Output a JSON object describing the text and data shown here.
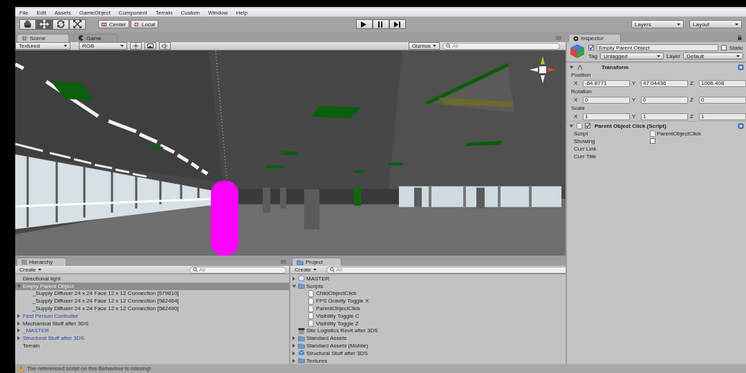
{
  "menu": [
    "File",
    "Edit",
    "Assets",
    "GameObject",
    "Component",
    "Terrain",
    "Custom",
    "Window",
    "Help"
  ],
  "toolbar": {
    "tools": [
      {
        "kind": "hand",
        "selected": false
      },
      {
        "kind": "move",
        "selected": true
      },
      {
        "kind": "rotate",
        "selected": false
      },
      {
        "kind": "scale",
        "selected": false
      }
    ],
    "pivot_buttons": [
      {
        "kind": "center",
        "label": "Center"
      },
      {
        "kind": "local",
        "label": "Local"
      }
    ],
    "playback": [
      {
        "kind": "play"
      },
      {
        "kind": "pause"
      },
      {
        "kind": "step"
      }
    ],
    "layers": "Layers",
    "layout": "Layout"
  },
  "scene_panel": {
    "tabs": [
      {
        "label": "Scene",
        "kind": "scene",
        "selected": true
      },
      {
        "label": "Game",
        "kind": "game",
        "selected": false
      }
    ],
    "render_mode": "Textured",
    "color_mode": "RGB",
    "toggles": [
      {
        "kind": "light"
      },
      {
        "kind": "image"
      },
      {
        "kind": "audio"
      }
    ],
    "gizmos": "Gizmos",
    "search_placeholder": "All"
  },
  "inspector": {
    "title": "Inspector",
    "active": true,
    "object_name": "Empty Parent Object",
    "static_label": "Static",
    "static": false,
    "tag_label": "Tag",
    "tag": "Untagged",
    "layer_label": "Layer",
    "layer": "Default",
    "components": [
      {
        "kind": "transform",
        "title": "Transform",
        "expanded": true,
        "groups": [
          {
            "label": "Position",
            "fields": [
              {
                "axis": "X",
                "value": "-64.8771"
              },
              {
                "axis": "Y",
                "value": "47.04436"
              },
              {
                "axis": "Z",
                "value": "1006.408"
              }
            ]
          },
          {
            "label": "Rotation",
            "fields": [
              {
                "axis": "X",
                "value": "0"
              },
              {
                "axis": "Y",
                "value": "0"
              },
              {
                "axis": "Z",
                "value": "0"
              }
            ]
          },
          {
            "label": "Scale",
            "fields": [
              {
                "axis": "X",
                "value": "1"
              },
              {
                "axis": "Y",
                "value": "1"
              },
              {
                "axis": "Z",
                "value": "1"
              }
            ]
          }
        ]
      },
      {
        "kind": "script",
        "title": "Parent Object Click (Script)",
        "expanded": true,
        "enabled": true,
        "properties": [
          {
            "label": "Script",
            "kind": "object",
            "value": "ParentObjectClick"
          },
          {
            "label": "Showing",
            "kind": "toggle",
            "checked": false
          },
          {
            "label": "Curr Link",
            "kind": "empty"
          },
          {
            "label": "Curr Title",
            "kind": "empty"
          }
        ]
      }
    ]
  },
  "hierarchy": {
    "title": "Hierarchy",
    "create": "Create",
    "search_placeholder": "All",
    "items": [
      {
        "label": "Directional light",
        "prefab": false,
        "selected": false
      },
      {
        "label": "Empty Parent Object",
        "prefab": false,
        "selected": true,
        "expanded": true,
        "children": [
          {
            "label": "_Supply Diffuser 24 x 24 Face 12 x 12 Connection [579810]",
            "prefab": false,
            "selected": false
          },
          {
            "label": "_Supply Diffuser 24 x 24 Face 12 x 12 Connection [582464]",
            "prefab": false,
            "selected": false
          },
          {
            "label": "_Supply Diffuser 24 x 24 Face 12 x 12 Connection [582490]",
            "prefab": false,
            "selected": false
          }
        ]
      },
      {
        "label": "First Person Controller",
        "prefab": true,
        "selected": false,
        "expanded": false
      },
      {
        "label": "Mechanical Stuff after 3DS",
        "prefab": false,
        "selected": false,
        "expanded": false
      },
      {
        "label": "_MASTER",
        "prefab": true,
        "selected": false,
        "expanded": false
      },
      {
        "label": "Structural Stuff after 3DS",
        "prefab": true,
        "selected": false,
        "expanded": false
      },
      {
        "label": "Terrain",
        "prefab": false,
        "selected": false
      }
    ]
  },
  "project": {
    "title": "Project",
    "create": "Create",
    "search_placeholder": "All",
    "items": [
      {
        "label": "MASTER",
        "kind": "scene",
        "expanded": false,
        "selected": false
      },
      {
        "label": "Scripts",
        "kind": "folder",
        "expanded": true,
        "selected": false,
        "children": [
          {
            "label": "ChildObjectClick",
            "kind": "script",
            "selected": false
          },
          {
            "label": "FPS Gravity Toggle X",
            "kind": "script",
            "selected": false
          },
          {
            "label": "ParentObjectClick",
            "kind": "script",
            "selected": false
          },
          {
            "label": "Visibility Toggle C",
            "kind": "script",
            "selected": false
          },
          {
            "label": "Visibility Toggle Z",
            "kind": "script",
            "selected": false
          }
        ]
      },
      {
        "label": "Site Logistics Revit after 3DS",
        "kind": "model",
        "selected": false
      },
      {
        "label": "Standard Assets",
        "kind": "folder",
        "expanded": false,
        "selected": false
      },
      {
        "label": "Standard Assets (Mobile)",
        "kind": "folder",
        "expanded": false,
        "selected": false
      },
      {
        "label": "Structural Stuff after 3DS",
        "kind": "prefab",
        "expanded": false,
        "selected": false
      },
      {
        "label": "Textures",
        "kind": "folder",
        "expanded": false,
        "selected": false
      }
    ]
  },
  "status_bar": {
    "kind": "warning",
    "message": "The referenced script on this Behaviour is missing!"
  }
}
